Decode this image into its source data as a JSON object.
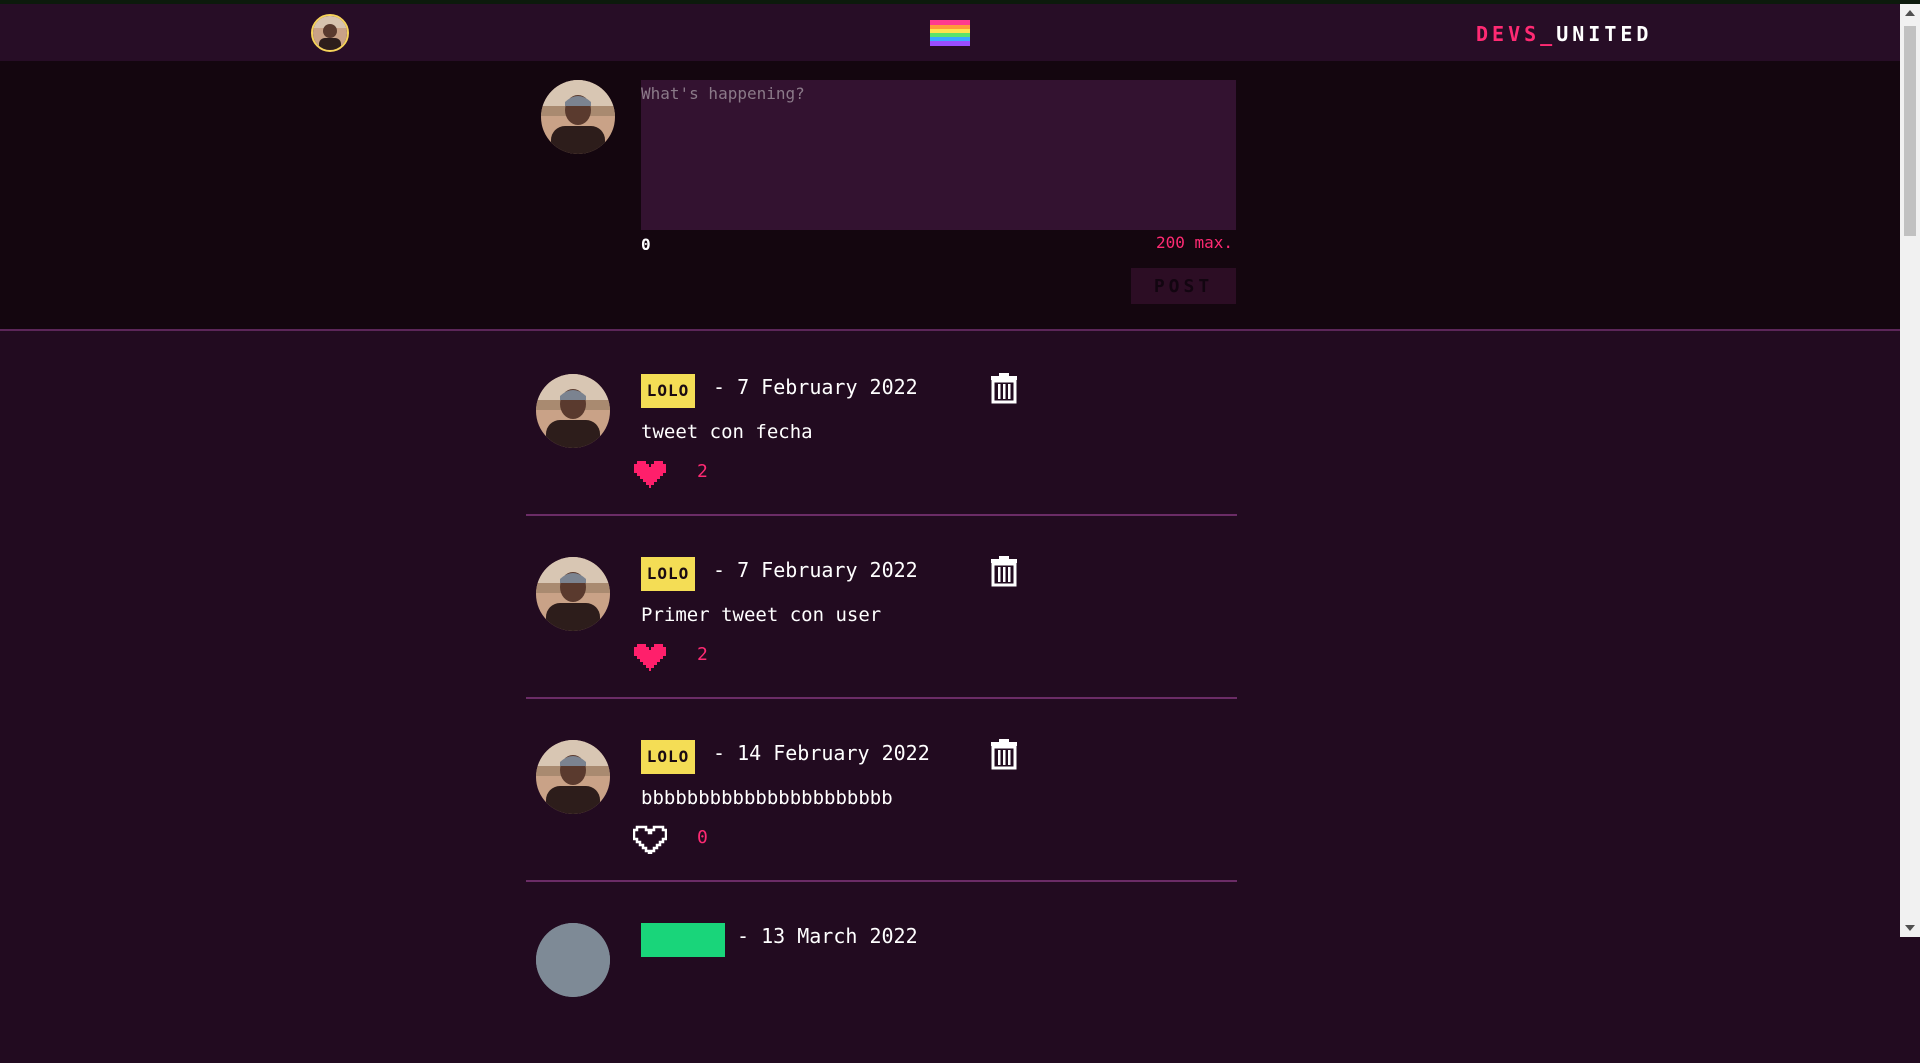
{
  "navbar": {
    "brand_part1": "DEVS_",
    "brand_part2": "UNITED",
    "avatar_icon": "user-avatar",
    "logo_icon": "rainbow-logo"
  },
  "composer": {
    "placeholder": "What's happening?",
    "char_count": "0",
    "max_label": "200 max.",
    "post_label": "POST"
  },
  "tweets": [
    {
      "user": "LOLO",
      "date": "- 7 February 2022",
      "text": "tweet con fecha",
      "likes": "2",
      "liked": true
    },
    {
      "user": "LOLO",
      "date": "- 7 February 2022",
      "text": "Primer tweet con user",
      "likes": "2",
      "liked": true
    },
    {
      "user": "LOLO",
      "date": "- 14 February 2022",
      "text": "bbbbbbbbbbbbbbbbbbbbbb",
      "likes": "0",
      "liked": false
    },
    {
      "user": "",
      "date": "- 13 March 2022",
      "text": "",
      "likes": "",
      "liked": false
    }
  ],
  "colors": {
    "accent_pink": "#ff2a73",
    "user_badge_yellow": "#f4dd55",
    "user_badge_green": "#19d57a",
    "background": "#220b20"
  }
}
